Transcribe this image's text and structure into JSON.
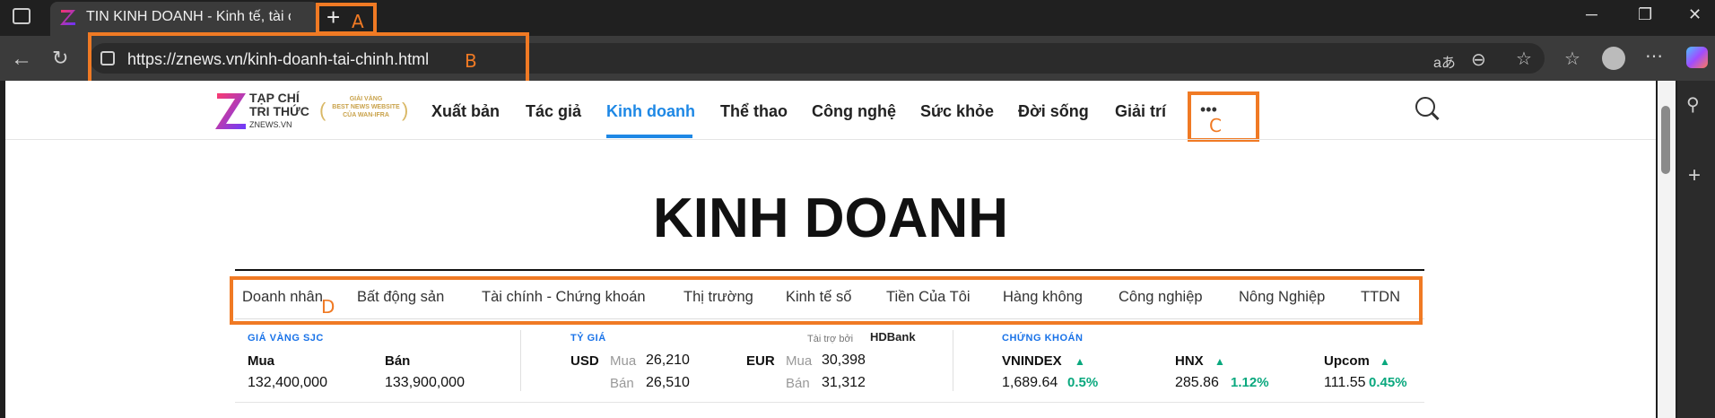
{
  "browser": {
    "tab_title": "TIN KINH DOANH - Kinh tế, tài ch",
    "url": "https://znews.vn/kinh-doanh-tai-chinh.html",
    "new_tab_label": "+"
  },
  "annotations": {
    "A": "A",
    "B": "B",
    "C": "C",
    "D": "D"
  },
  "site": {
    "logo_line1": "TẠP CHÍ",
    "logo_line2": "TRI THỨC",
    "logo_line3": "ZNEWS.VN",
    "award_line1": "GIẢI VÀNG",
    "award_line2": "BEST NEWS WEBSITE",
    "award_line3": "CỦA WAN-IFRA",
    "nav": [
      "Xuất bản",
      "Tác giả",
      "Kinh doanh",
      "Thể thao",
      "Công nghệ",
      "Sức khỏe",
      "Đời sống",
      "Giải trí"
    ],
    "more": "•••",
    "page_title": "KINH DOANH",
    "subnav": [
      "Doanh nhân",
      "Bất động sản",
      "Tài chính - Chứng khoán",
      "Thị trường",
      "Kinh tế số",
      "Tiền Của Tôi",
      "Hàng không",
      "Công nghiệp",
      "Nông Nghiệp",
      "TTDN"
    ]
  },
  "gold": {
    "heading": "GIÁ VÀNG SJC",
    "buy_label": "Mua",
    "sell_label": "Bán",
    "buy_value": "132,400,000",
    "sell_value": "133,900,000"
  },
  "fx": {
    "heading": "TỶ GIÁ",
    "sponsor": "Tài trợ bởi",
    "bank": "HDBank",
    "usd": {
      "code": "USD",
      "buy_label": "Mua",
      "buy": "26,210",
      "sell_label": "Bán",
      "sell": "26,510"
    },
    "eur": {
      "code": "EUR",
      "buy_label": "Mua",
      "buy": "30,398",
      "sell_label": "Bán",
      "sell": "31,312"
    }
  },
  "stocks": {
    "heading": "CHỨNG KHOÁN",
    "items": [
      {
        "name": "VNINDEX",
        "value": "1,689.64",
        "change": "0.5%"
      },
      {
        "name": "HNX",
        "value": "285.86",
        "change": "1.12%"
      },
      {
        "name": "Upcom",
        "value": "111.55",
        "change": "0.45%"
      }
    ]
  },
  "colors": {
    "accent": "#1e88e5",
    "annotation": "#f07a24",
    "up": "#0aa87e"
  }
}
